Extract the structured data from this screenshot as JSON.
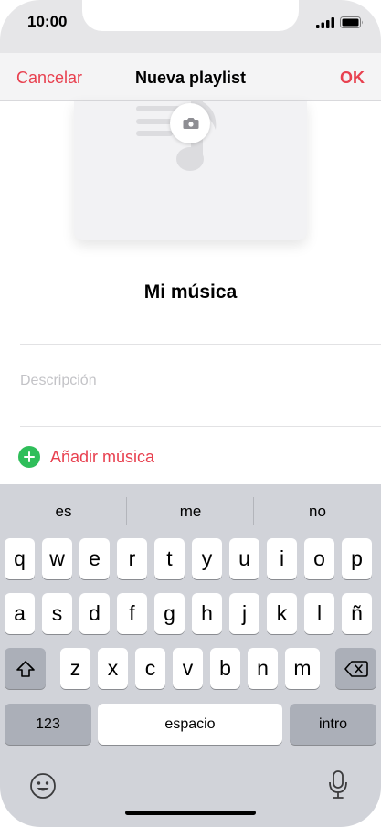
{
  "status_bar": {
    "time": "10:00"
  },
  "nav": {
    "cancel_label": "Cancelar",
    "title": "Nueva playlist",
    "ok_label": "OK"
  },
  "artwork": {
    "icon": "music-note-with-camera"
  },
  "playlist": {
    "name": "Mi música",
    "description_placeholder": "Descripción",
    "add_music_label": "Añadir música"
  },
  "keyboard": {
    "suggestions": [
      "es",
      "me",
      "no"
    ],
    "row1": [
      "q",
      "w",
      "e",
      "r",
      "t",
      "y",
      "u",
      "i",
      "o",
      "p"
    ],
    "row2": [
      "a",
      "s",
      "d",
      "f",
      "g",
      "h",
      "j",
      "k",
      "l",
      "ñ"
    ],
    "row3": [
      "z",
      "x",
      "c",
      "v",
      "b",
      "n",
      "m"
    ],
    "numbers_label": "123",
    "space_label": "espacio",
    "return_label": "intro"
  },
  "colors": {
    "accent": "#e8404f",
    "add": "#2fbe5a"
  }
}
